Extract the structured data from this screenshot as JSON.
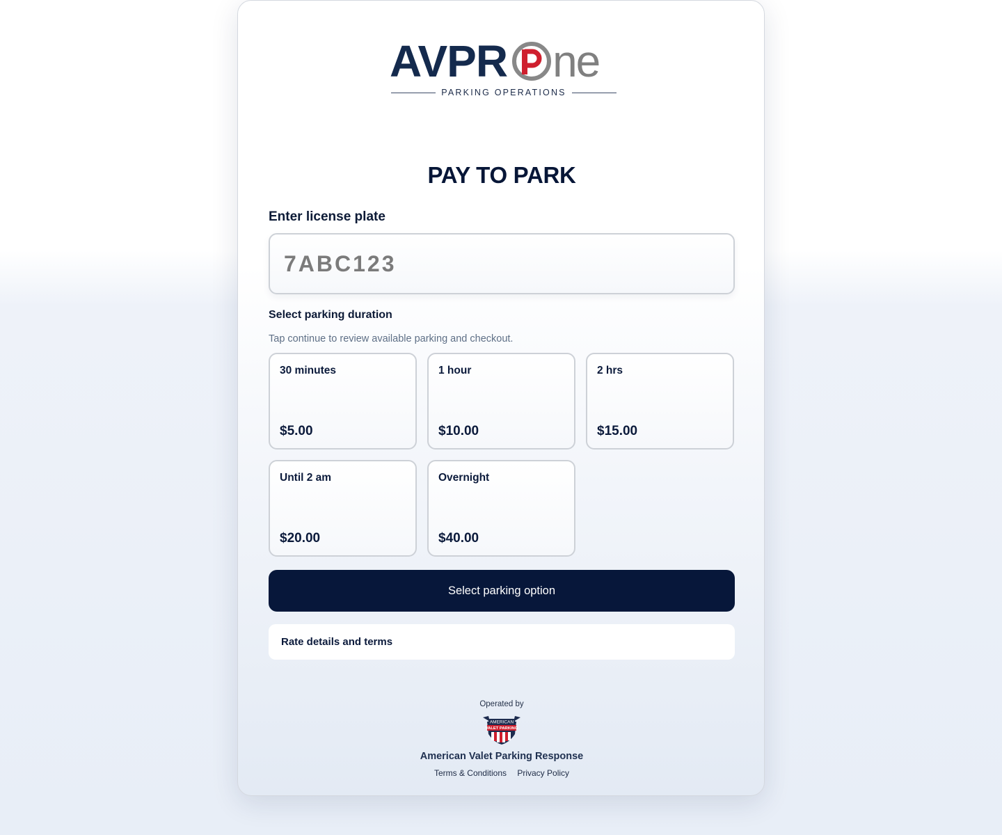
{
  "logo": {
    "part1": "AVPR",
    "part2": "ne",
    "tagline": "PARKING OPERATIONS"
  },
  "page": {
    "title": "PAY TO PARK"
  },
  "plate": {
    "label": "Enter license plate",
    "placeholder": "7ABC123"
  },
  "duration": {
    "label": "Select parking duration",
    "hint": "Tap continue to review available parking and checkout.",
    "options": [
      {
        "name": "30 minutes",
        "price": "$5.00"
      },
      {
        "name": "1 hour",
        "price": "$10.00"
      },
      {
        "name": "2 hrs",
        "price": "$15.00"
      },
      {
        "name": "Until 2 am",
        "price": "$20.00"
      },
      {
        "name": "Overnight",
        "price": "$40.00"
      }
    ]
  },
  "actions": {
    "select_label": "Select parking option",
    "rate_details_label": "Rate details and terms"
  },
  "footer": {
    "operated_by": "Operated by",
    "badge_text_top": "AMERICAN",
    "badge_text_mid": "VALET PARKING",
    "company": "American Valet Parking Response",
    "terms_label": "Terms & Conditions",
    "privacy_label": "Privacy Policy"
  },
  "colors": {
    "navy": "#07173a",
    "logo_red": "#cf1f2e",
    "logo_grey": "#808080"
  },
  "icons": {
    "logo_o": "parking-p-ring-icon",
    "badge": "american-valet-shield-icon"
  }
}
